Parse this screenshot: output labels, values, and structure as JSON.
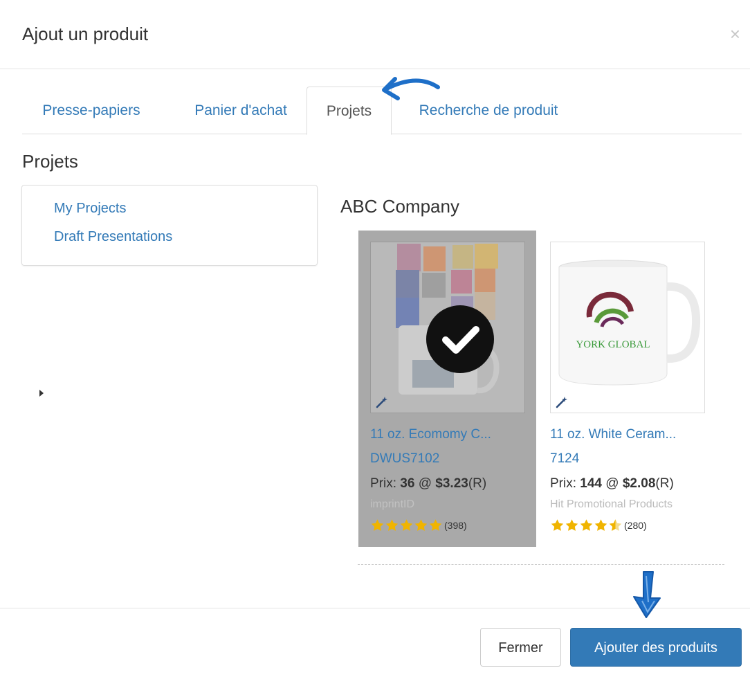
{
  "modal": {
    "title": "Ajout un produit",
    "close_symbol": "×"
  },
  "tabs": [
    {
      "label": "Presse-papiers",
      "active": false
    },
    {
      "label": "Panier d'achat",
      "active": false
    },
    {
      "label": "Projets",
      "active": true
    },
    {
      "label": "Recherche de produit",
      "active": false
    }
  ],
  "projects": {
    "title": "Projets",
    "tree": [
      {
        "label": "My Projects",
        "icon": "caret-right-icon"
      },
      {
        "label": "Draft Presentations"
      }
    ]
  },
  "company": "ABC Company",
  "products": [
    {
      "name": "11 oz. Ecomomy C...",
      "code": "DWUS7102",
      "price_prefix": "Prix: ",
      "quantity": "36",
      "price_sep": " @ ",
      "price": "$3.23",
      "price_suffix": "(R)",
      "supplier": "imprintID",
      "rating": 5,
      "review_count": "(398)",
      "selected": true
    },
    {
      "name": "11 oz. White Ceram...",
      "code": "7124",
      "price_prefix": "Prix: ",
      "quantity": "144",
      "price_sep": " @ ",
      "price": "$2.08",
      "price_suffix": "(R)",
      "supplier": "Hit Promotional Products",
      "rating": 4.5,
      "review_count": "(280)",
      "selected": false,
      "logo_text": "YORK GLOBAL"
    }
  ],
  "footer": {
    "close_label": "Fermer",
    "add_label": "Ajouter des produits"
  },
  "colors": {
    "link": "#337ab7",
    "primary_button": "#337ab7",
    "star": "#f0b400",
    "selected_overlay": "#a9a9a9",
    "annotation_arrow": "#1e6fc8"
  }
}
